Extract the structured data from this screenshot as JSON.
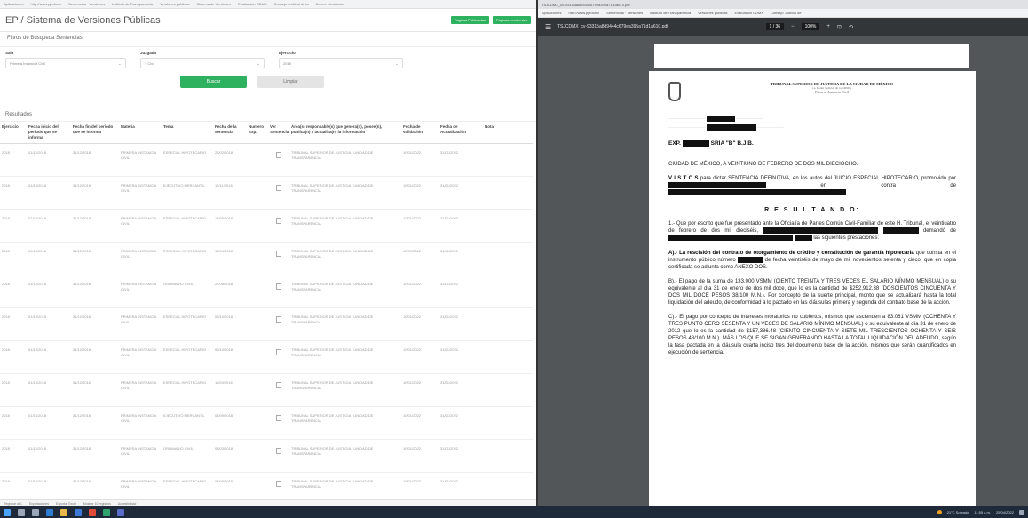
{
  "left_window": {
    "bookmarks": [
      "Aplicaciones",
      "http://www.pjedomx",
      "Sentencias · Versiones",
      "Instituto de Transparencia",
      "Versiones publicas",
      "Sistema de Versiones",
      "Evaluación CDMX",
      "Consejo Judicial de la",
      "Correo electrónico"
    ],
    "app_title": "EP / Sistema de Versiones Públicas",
    "header_buttons": [
      "Páginas Publicadas",
      "Páginas pendientes"
    ],
    "filters_title": "Filtros de Búsqueda Sentencias",
    "filters": [
      {
        "label": "Sala",
        "value": "Primera Instancia Civil"
      },
      {
        "label": "Juzgado",
        "value": "1 Civil"
      },
      {
        "label": "Ejercicio",
        "value": "2018"
      }
    ],
    "search_button": "Buscar",
    "clear_button": "Limpiar",
    "results_title": "Resultados",
    "table": {
      "headers": [
        "Ejercicio",
        "Fecha inicio del periodo que se informa",
        "Fecha fin del periodo que se informa",
        "Materia",
        "Tema",
        "Fecha de la sentencia",
        "Numero Exp.",
        "Ver Sentencia",
        "Área(s) responsable(s) que genera(n), posee(n), publica(n) y actualiza(n) la información",
        "Fecha de validación",
        "Fecha de Actualización",
        "Nota"
      ],
      "rows": [
        {
          "ejercicio": "2018",
          "inicio": "01/10/2018",
          "fin": "31/12/2018",
          "materia": "PRIMERA INSTANCIA CIVIL",
          "tema": "ESPECIAL HIPOTECARIO",
          "fecha": "22/02/2018",
          "area": "TRIBUNAL SUPERIOR DE JUSTICIA / UNIDAD DE TRANSPARENCIA",
          "validacion": "10/01/2022",
          "actualizacion": "31/01/2022"
        },
        {
          "ejercicio": "2018",
          "inicio": "01/10/2018",
          "fin": "31/12/2018",
          "materia": "PRIMERA INSTANCIA CIVIL",
          "tema": "EJECUTIVO MERCANTIL",
          "fecha": "12/11/2018",
          "area": "TRIBUNAL SUPERIOR DE JUSTICIA / UNIDAD DE TRANSPARENCIA",
          "validacion": "10/01/2022",
          "actualizacion": "31/01/2022"
        },
        {
          "ejercicio": "2018",
          "inicio": "01/10/2018",
          "fin": "31/12/2018",
          "materia": "PRIMERA INSTANCIA CIVIL",
          "tema": "ESPECIAL HIPOTECARIO",
          "fecha": "15/05/2018",
          "area": "TRIBUNAL SUPERIOR DE JUSTICIA / UNIDAD DE TRANSPARENCIA",
          "validacion": "10/01/2022",
          "actualizacion": "31/01/2022"
        },
        {
          "ejercicio": "2018",
          "inicio": "01/10/2018",
          "fin": "31/12/2018",
          "materia": "PRIMERA INSTANCIA CIVIL",
          "tema": "ESPECIAL HIPOTECARIO",
          "fecha": "13/04/2018",
          "area": "TRIBUNAL SUPERIOR DE JUSTICIA / UNIDAD DE TRANSPARENCIA",
          "validacion": "10/01/2022",
          "actualizacion": "31/01/2022"
        },
        {
          "ejercicio": "2018",
          "inicio": "01/10/2018",
          "fin": "31/12/2018",
          "materia": "PRIMERA INSTANCIA CIVIL",
          "tema": "ORDINARIO CIVIL",
          "fecha": "27/08/2018",
          "area": "TRIBUNAL SUPERIOR DE JUSTICIA / UNIDAD DE TRANSPARENCIA",
          "validacion": "10/01/2022",
          "actualizacion": "31/01/2022"
        },
        {
          "ejercicio": "2018",
          "inicio": "01/10/2018",
          "fin": "31/12/2018",
          "materia": "PRIMERA INSTANCIA CIVIL",
          "tema": "ESPECIAL HIPOTECARIO",
          "fecha": "09/10/2018",
          "area": "TRIBUNAL SUPERIOR DE JUSTICIA / UNIDAD DE TRANSPARENCIA",
          "validacion": "10/01/2022",
          "actualizacion": "31/01/2022"
        },
        {
          "ejercicio": "2018",
          "inicio": "01/10/2018",
          "fin": "31/12/2018",
          "materia": "PRIMERA INSTANCIA CIVIL",
          "tema": "ESPECIAL HIPOTECARIO",
          "fecha": "09/10/2018",
          "area": "TRIBUNAL SUPERIOR DE JUSTICIA / UNIDAD DE TRANSPARENCIA",
          "validacion": "10/01/2022",
          "actualizacion": "31/01/2022"
        },
        {
          "ejercicio": "2018",
          "inicio": "01/10/2018",
          "fin": "31/12/2018",
          "materia": "PRIMERA INSTANCIA CIVIL",
          "tema": "ESPECIAL HIPOTECARIO",
          "fecha": "11/09/2018",
          "area": "TRIBUNAL SUPERIOR DE JUSTICIA / UNIDAD DE TRANSPARENCIA",
          "validacion": "10/01/2022",
          "actualizacion": "31/01/2022"
        },
        {
          "ejercicio": "2018",
          "inicio": "01/10/2018",
          "fin": "31/12/2018",
          "materia": "PRIMERA INSTANCIA CIVIL",
          "tema": "EJECUTIVO MERCANTIL",
          "fecha": "05/09/2018",
          "area": "TRIBUNAL SUPERIOR DE JUSTICIA / UNIDAD DE TRANSPARENCIA",
          "validacion": "10/01/2022",
          "actualizacion": "31/01/2022"
        },
        {
          "ejercicio": "2018",
          "inicio": "01/10/2018",
          "fin": "31/12/2018",
          "materia": "PRIMERA INSTANCIA CIVIL",
          "tema": "ORDINARIO CIVIL",
          "fecha": "03/03/2018",
          "area": "TRIBUNAL SUPERIOR DE JUSTICIA / UNIDAD DE TRANSPARENCIA",
          "validacion": "10/01/2022",
          "actualizacion": "31/01/2022"
        },
        {
          "ejercicio": "2018",
          "inicio": "01/10/2018",
          "fin": "31/12/2018",
          "materia": "PRIMERA INSTANCIA CIVIL",
          "tema": "ESPECIAL HIPOTECARIO",
          "fecha": "03/08/2018",
          "area": "TRIBUNAL SUPERIOR DE JUSTICIA / UNIDAD DE TRANSPARENCIA",
          "validacion": "10/01/2022",
          "actualizacion": "31/01/2022"
        }
      ]
    },
    "status_strip": [
      "Registrar al 1",
      "Exportaciones",
      "Exportar Excel",
      "Mostrar 10 registros",
      "Accesibilidad"
    ]
  },
  "right_window": {
    "bookmarks": [
      "Aplicaciones",
      "http://www.pjedomx",
      "Sentencias · Versiones",
      "Instituto de Transparencia",
      "Versiones publicas",
      "Evaluación CDMX",
      "Consejo Judicial de"
    ],
    "pdf_filename": "TSJCDMX_cv-93315a8d9444c679ea395a71d1a610.pdf",
    "page_indicator": "1 / 36",
    "zoom": "100%",
    "document": {
      "court_title": "TRIBUNAL SUPERIOR DE JUSTICIA DE LA CIUDAD DE MÉXICO",
      "court_subtitle": "1a. Poder Judicial de la CDMX",
      "court_section": "Primera Instancia Civil",
      "exp_label": "EXP.",
      "exp_suffix": "SRIA \"B\" B.J.B.",
      "city_date": "CIUDAD DE MÉXICO, A VEINTIUNO DE FEBRERO DE DOS MIL DIECIOCHO.",
      "vistos_head": "V I S T O S",
      "vistos_text": "para dictar SENTENCIA DEFINITIVA, en los autos del JUICIO ESPECIAL HIPOTECARIO, promovido por",
      "vistos_end": "en contra de",
      "resultando": "R E S U L T A N D O:",
      "p1": "1.- Que por escrito que fue presentado ante la Oficialía de Partes Común Civil-Familiar de este H. Tribunal, el veintiuatro de febrero de dos mil dieciséis,",
      "p1b": "demandó de",
      "p1c": "las siguientes prestaciones:",
      "pA_bold": "A).- La rescisión del contrato de otorgamiento de crédito y constitución de garantía hipotecaria",
      "pA_rest": "que consta en el instrumento público número",
      "pA_end": "de fecha veintiséis de mayo de mil novecientos setenta y cinco, que en copia certificada se adjunta como ANEXO DOS.",
      "pB": "B).- El pago de la suma de 133.000 VSMM (CIENTO TREINTA Y TRES VECES EL SALARIO MÍNIMO MENSUAL) o su equivalente al día 31 de enero de dos mil doce, que lo es la cantidad de $252,912.38 (DOSCIENTOS CINCUENTA Y DOS MIL DOCE PESOS 38/100 M.N.). Por concepto de la suerte principal, monto que se actualizará hasta la total liquidación del adeudo, de conformidad a lo pactado en las cláusulas primera y segunda del contrato base de la acción.",
      "pC": "C).- El pago por concepto de intereses moratorios no cubiertos, mismos que ascienden a 83.061 VSMM (OCHENTA Y TRES PUNTO CERO SESENTA Y UN VECES DE SALARIO MÍNIMO MENSUAL) o su equivalente al día 31 de enero de 2012 que lo es la cantidad de $157,386.48 (CIENTO CINCUENTA Y SIETE MIL TRESCIENTOS OCHENTA Y SEIS PESOS 48/100 M.N.). MÁS LOS QUE SE SIGAN GENERANDO HASTA LA TOTAL LIQUIDACIÓN DEL ADEUDO, según la tasa pactada en la cláusula cuarta inciso tres del documento base de la acción, mismos que serán cuantificados en ejecución de sentencia."
    }
  },
  "taskbar": {
    "weather": "21°C Soleado",
    "time": "11:55 a.m.",
    "date": "25/04/2022"
  }
}
